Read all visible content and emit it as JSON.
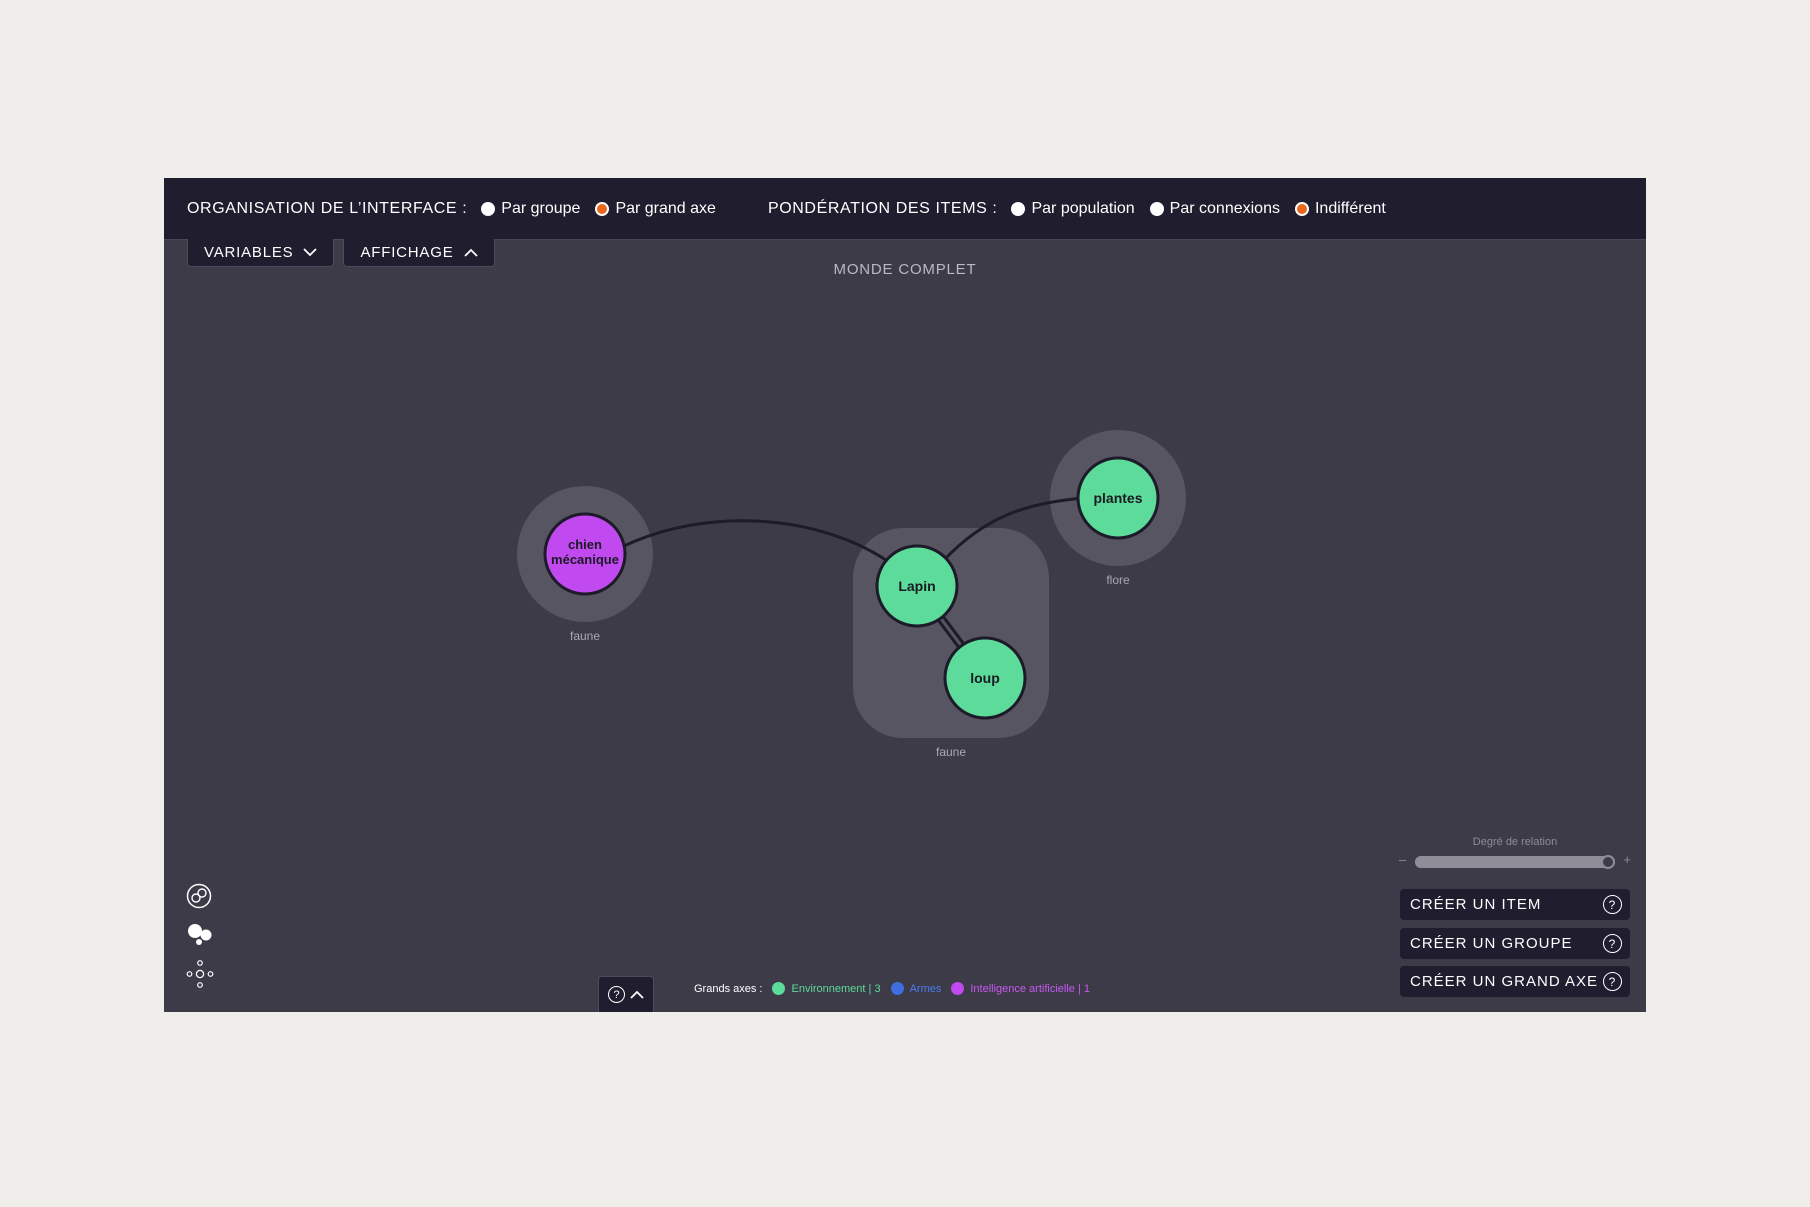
{
  "topbar": {
    "organisation_label": "ORGANISATION DE L’INTERFACE :",
    "organisation_options": [
      {
        "label": "Par groupe",
        "selected": false
      },
      {
        "label": "Par grand axe",
        "selected": true
      }
    ],
    "ponderation_label": "PONDÉRATION DES ITEMS :",
    "ponderation_options": [
      {
        "label": "Par population",
        "selected": false
      },
      {
        "label": "Par connexions",
        "selected": false
      },
      {
        "label": "Indifférent",
        "selected": true
      }
    ]
  },
  "tabs": {
    "variables": "VARIABLES",
    "affichage": "AFFICHAGE"
  },
  "world_title": "MONDE COMPLET",
  "graph": {
    "groups": [
      {
        "label": "faune"
      },
      {
        "label": "flore"
      },
      {
        "label": "faune"
      }
    ],
    "nodes": [
      {
        "label_lines": [
          "chien",
          "mécanique"
        ],
        "axis": "Intelligence artificielle"
      },
      {
        "label_lines": [
          "Lapin"
        ],
        "axis": "Environnement"
      },
      {
        "label_lines": [
          "loup"
        ],
        "axis": "Environnement"
      },
      {
        "label_lines": [
          "plantes"
        ],
        "axis": "Environnement"
      }
    ]
  },
  "colors": {
    "environnement": "#5ddb9a",
    "armes": "#3f6ee0",
    "ia": "#c149f0",
    "accent": "#e8671b"
  },
  "slider": {
    "label": "Degré de relation",
    "minus": "–",
    "plus": "+",
    "level": 1.0
  },
  "actions": {
    "create_item": "CRÉER UN ITEM",
    "create_group": "CRÉER UN GROUPE",
    "create_axis": "CRÉER UN GRAND AXE",
    "help": "?"
  },
  "legend": {
    "title": "Grands axes :",
    "items": [
      {
        "label": "Environnement | 3",
        "color": "#5ddb9a"
      },
      {
        "label": "Armes",
        "color": "#3f6ee0"
      },
      {
        "label": "Intelligence artificielle | 1",
        "color": "#c149f0"
      }
    ]
  },
  "icons": {
    "view_groups": "groups-view-icon",
    "view_weighted": "bubbles-view-icon",
    "view_network": "network-view-icon"
  }
}
